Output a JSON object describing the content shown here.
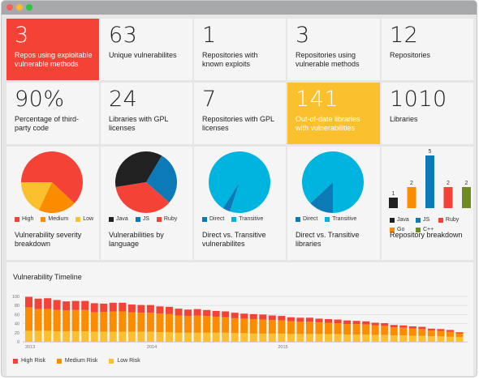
{
  "stats": [
    {
      "value": "3",
      "label": "Repos using exploitable vulnerable methods"
    },
    {
      "value": "63",
      "label": "Unique vulnerabilites"
    },
    {
      "value": "1",
      "label": "Repositories with known exploits"
    },
    {
      "value": "3",
      "label": "Repositories using vulnerable methods"
    },
    {
      "value": "12",
      "label": "Repositories"
    },
    {
      "value": "90%",
      "label": "Percentage of third-party code"
    },
    {
      "value": "24",
      "label": "Libraries with GPL licenses"
    },
    {
      "value": "7",
      "label": "Repositories with GPL licenses"
    },
    {
      "value": "141",
      "label": "Out-of-date libraries with vulnerabilities"
    },
    {
      "value": "1010",
      "label": "Libraries"
    }
  ],
  "colors": {
    "red": "#f44336",
    "orange": "#fb8c00",
    "amber": "#fbc02d",
    "dark": "#212121",
    "blue": "#0d7ab8",
    "cyan": "#00b4e0",
    "green": "#6d8b1f"
  },
  "charts": {
    "severity": {
      "title": "Vulnerability severity breakdown",
      "legend": [
        "High",
        "Medium",
        "Low"
      ],
      "chart_data": {
        "type": "pie",
        "categories": [
          "High",
          "Medium",
          "Low"
        ],
        "values": [
          62,
          20,
          18
        ]
      }
    },
    "language": {
      "title": "Vulnerabilities by language",
      "legend": [
        "Java",
        "JS",
        "Ruby"
      ],
      "chart_data": {
        "type": "pie",
        "categories": [
          "Java",
          "JS",
          "Ruby"
        ],
        "values": [
          36,
          28,
          36
        ]
      }
    },
    "direct_vulns": {
      "title": "Direct vs. Transitive vulnerabilites",
      "legend": [
        "Direct",
        "Transitive"
      ],
      "chart_data": {
        "type": "pie",
        "categories": [
          "Direct",
          "Transitive"
        ],
        "values": [
          4,
          96
        ]
      }
    },
    "direct_libs": {
      "title": "Direct vs. Transitive libraries",
      "legend": [
        "Direct",
        "Transitive"
      ],
      "chart_data": {
        "type": "pie",
        "categories": [
          "Direct",
          "Transitive"
        ],
        "values": [
          13,
          87
        ]
      }
    },
    "repos": {
      "title": "Repository breakdown",
      "legend": [
        "Java",
        "JS",
        "Ruby",
        "Go",
        "C++"
      ],
      "chart_data": {
        "type": "bar",
        "categories": [
          "Java",
          "Go",
          "JS",
          "Ruby",
          "C++"
        ],
        "values": [
          1,
          2,
          5,
          2,
          2
        ]
      }
    }
  },
  "timeline": {
    "title": "Vulnerability Timeline",
    "legend": [
      "High Risk",
      "Medium Risk",
      "Low Risk"
    ],
    "chart_data": {
      "type": "bar",
      "stacked": true,
      "title": "Vulnerability Timeline",
      "ylim": [
        0,
        100
      ],
      "yticks": [
        "0",
        "20",
        "40",
        "60",
        "80",
        "100"
      ],
      "xticks": [
        "2013",
        "2014",
        "2015"
      ],
      "series": [
        {
          "name": "Low Risk",
          "values": [
            24,
            24,
            24,
            23,
            23,
            23,
            23,
            22,
            22,
            22,
            22,
            22,
            22,
            22,
            21,
            21,
            20,
            20,
            20,
            20,
            20,
            20,
            19,
            19,
            18,
            18,
            18,
            18,
            17,
            17,
            17,
            17,
            17,
            17,
            16,
            16,
            16,
            15,
            15,
            14,
            14,
            13,
            13,
            12,
            12,
            11,
            10
          ]
        },
        {
          "name": "Medium Risk",
          "values": [
            52,
            48,
            48,
            47,
            46,
            47,
            47,
            43,
            44,
            45,
            45,
            43,
            42,
            42,
            41,
            40,
            38,
            37,
            38,
            37,
            35,
            34,
            33,
            32,
            32,
            31,
            30,
            29,
            28,
            27,
            27,
            26,
            25,
            24,
            23,
            23,
            22,
            21,
            20,
            18,
            17,
            16,
            15,
            13,
            12,
            11,
            8
          ]
        },
        {
          "name": "High Risk",
          "values": [
            23,
            23,
            24,
            22,
            20,
            20,
            20,
            20,
            18,
            19,
            19,
            17,
            17,
            17,
            16,
            16,
            15,
            14,
            14,
            13,
            13,
            13,
            12,
            11,
            11,
            11,
            10,
            10,
            9,
            9,
            9,
            8,
            8,
            8,
            8,
            7,
            7,
            6,
            6,
            5,
            5,
            5,
            5,
            4,
            4,
            4,
            3
          ]
        }
      ]
    }
  }
}
